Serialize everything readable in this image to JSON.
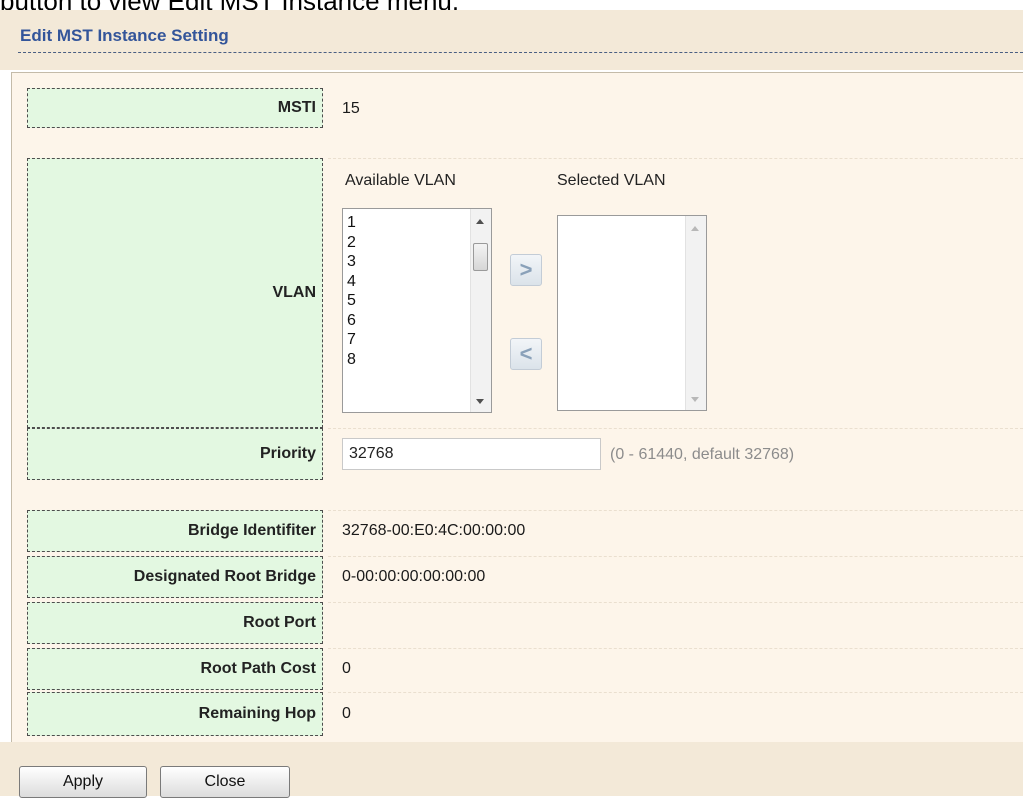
{
  "caption_cut": "button to view Edit MST Instance menu.",
  "title": "Edit MST Instance Setting",
  "rows": {
    "msti": {
      "label": "MSTI",
      "value": "15"
    },
    "vlan": {
      "label": "VLAN"
    },
    "priority": {
      "label": "Priority",
      "value": "32768",
      "hint": "(0 - 61440, default 32768)"
    },
    "bridge_identifier": {
      "label": "Bridge Identifiter",
      "value": "32768-00:E0:4C:00:00:00"
    },
    "designated_root_bridge": {
      "label": "Designated Root Bridge",
      "value": "0-00:00:00:00:00:00"
    },
    "root_port": {
      "label": "Root Port",
      "value": ""
    },
    "root_path_cost": {
      "label": "Root Path Cost",
      "value": "0"
    },
    "remaining_hop": {
      "label": "Remaining Hop",
      "value": "0"
    }
  },
  "vlan": {
    "available_label": "Available VLAN",
    "selected_label": "Selected VLAN",
    "available_items": [
      "1",
      "2",
      "3",
      "4",
      "5",
      "6",
      "7",
      "8"
    ],
    "selected_items": [],
    "add_glyph": ">",
    "remove_glyph": "<"
  },
  "buttons": {
    "apply": "Apply",
    "close": "Close"
  },
  "colors": {
    "label_bg": "#e3f8e1",
    "panel_bg": "#fdf5ea",
    "band_bg": "#f3e9d8",
    "title": "#33559a"
  }
}
